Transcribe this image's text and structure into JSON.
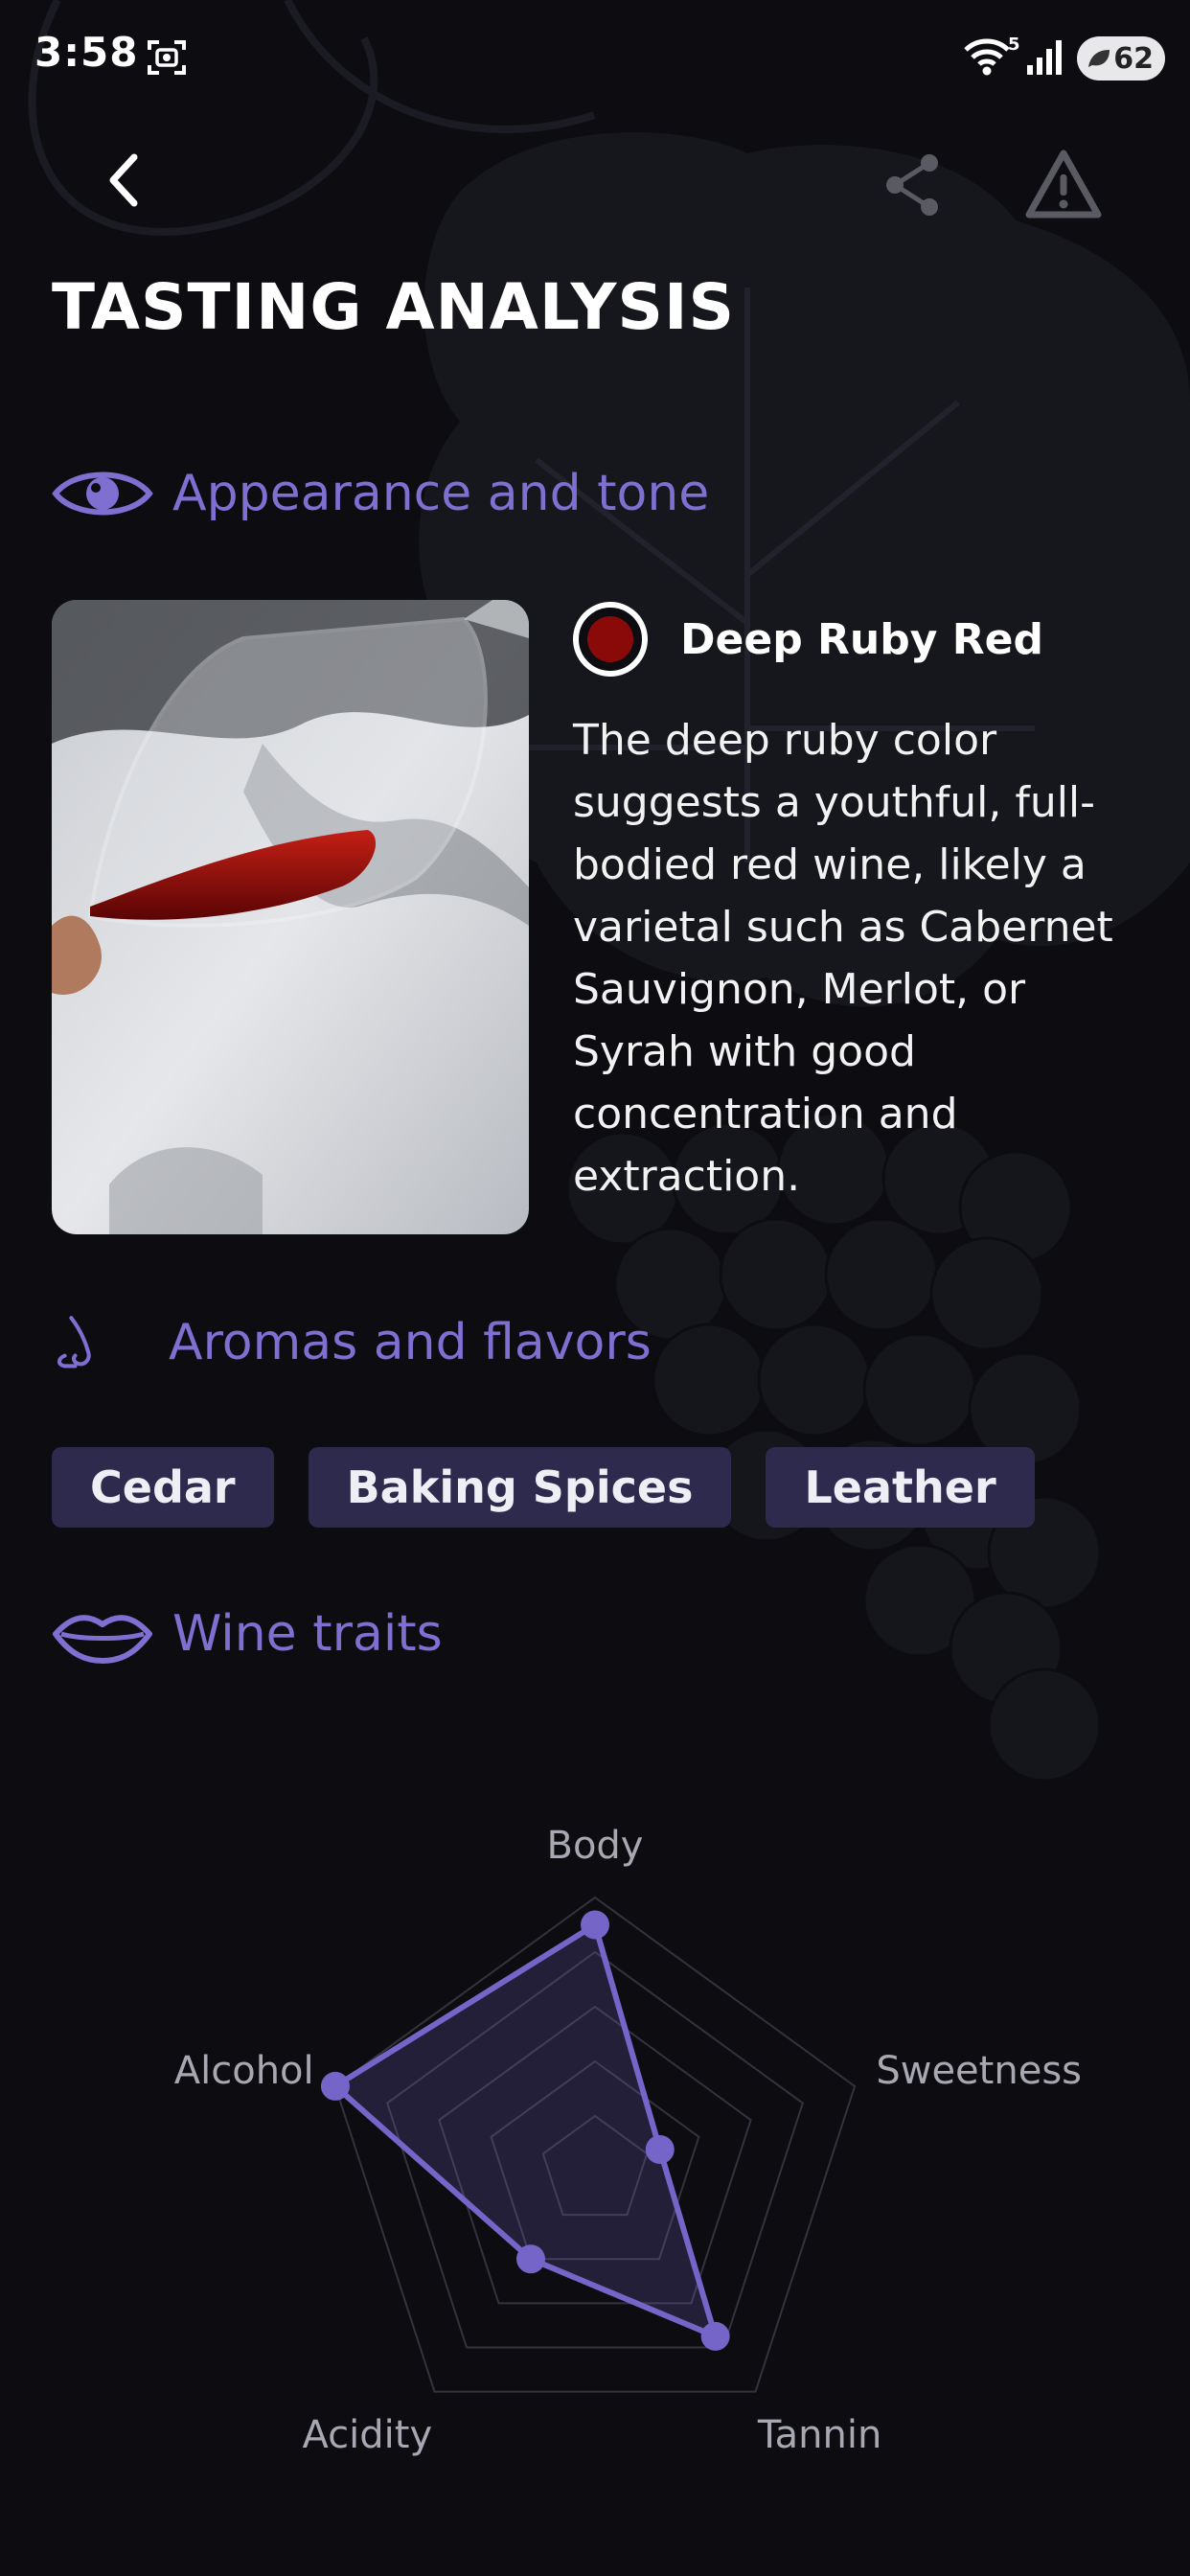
{
  "status_bar": {
    "time": "3:58",
    "wifi_badge": "5",
    "battery_level": "62"
  },
  "nav": {
    "back_icon": "chevron-left-icon",
    "share_icon": "share-icon",
    "report_icon": "warning-icon"
  },
  "page_title": "TASTING ANALYSIS",
  "sections": {
    "appearance": {
      "label": "Appearance and tone",
      "icon": "eye-icon"
    },
    "aromas": {
      "label": "Aromas and flavors",
      "icon": "nose-icon"
    },
    "traits": {
      "label": "Wine traits",
      "icon": "lips-icon"
    }
  },
  "appearance": {
    "color_name": "Deep Ruby Red",
    "color_hex": "#8a0a0a",
    "description": "The deep ruby color suggests a youthful, full-bodied red wine, likely a varietal such as Cabernet Sauvignon, Merlot, or Syrah with good concentration and extraction."
  },
  "aromas": [
    "Cedar",
    "Baking Spices",
    "Leather"
  ],
  "chart_data": {
    "type": "radar",
    "axes": [
      "Body",
      "Sweetness",
      "Tannin",
      "Acidity",
      "Alcohol"
    ],
    "values": [
      0.9,
      0.25,
      0.75,
      0.4,
      1.0
    ],
    "range": [
      0,
      1
    ],
    "grid_levels": 5,
    "accent_color": "#7565c9"
  },
  "colors": {
    "background": "#0c0c11",
    "accent": "#7e6fd0",
    "tag_background": "#2d2a4e"
  }
}
